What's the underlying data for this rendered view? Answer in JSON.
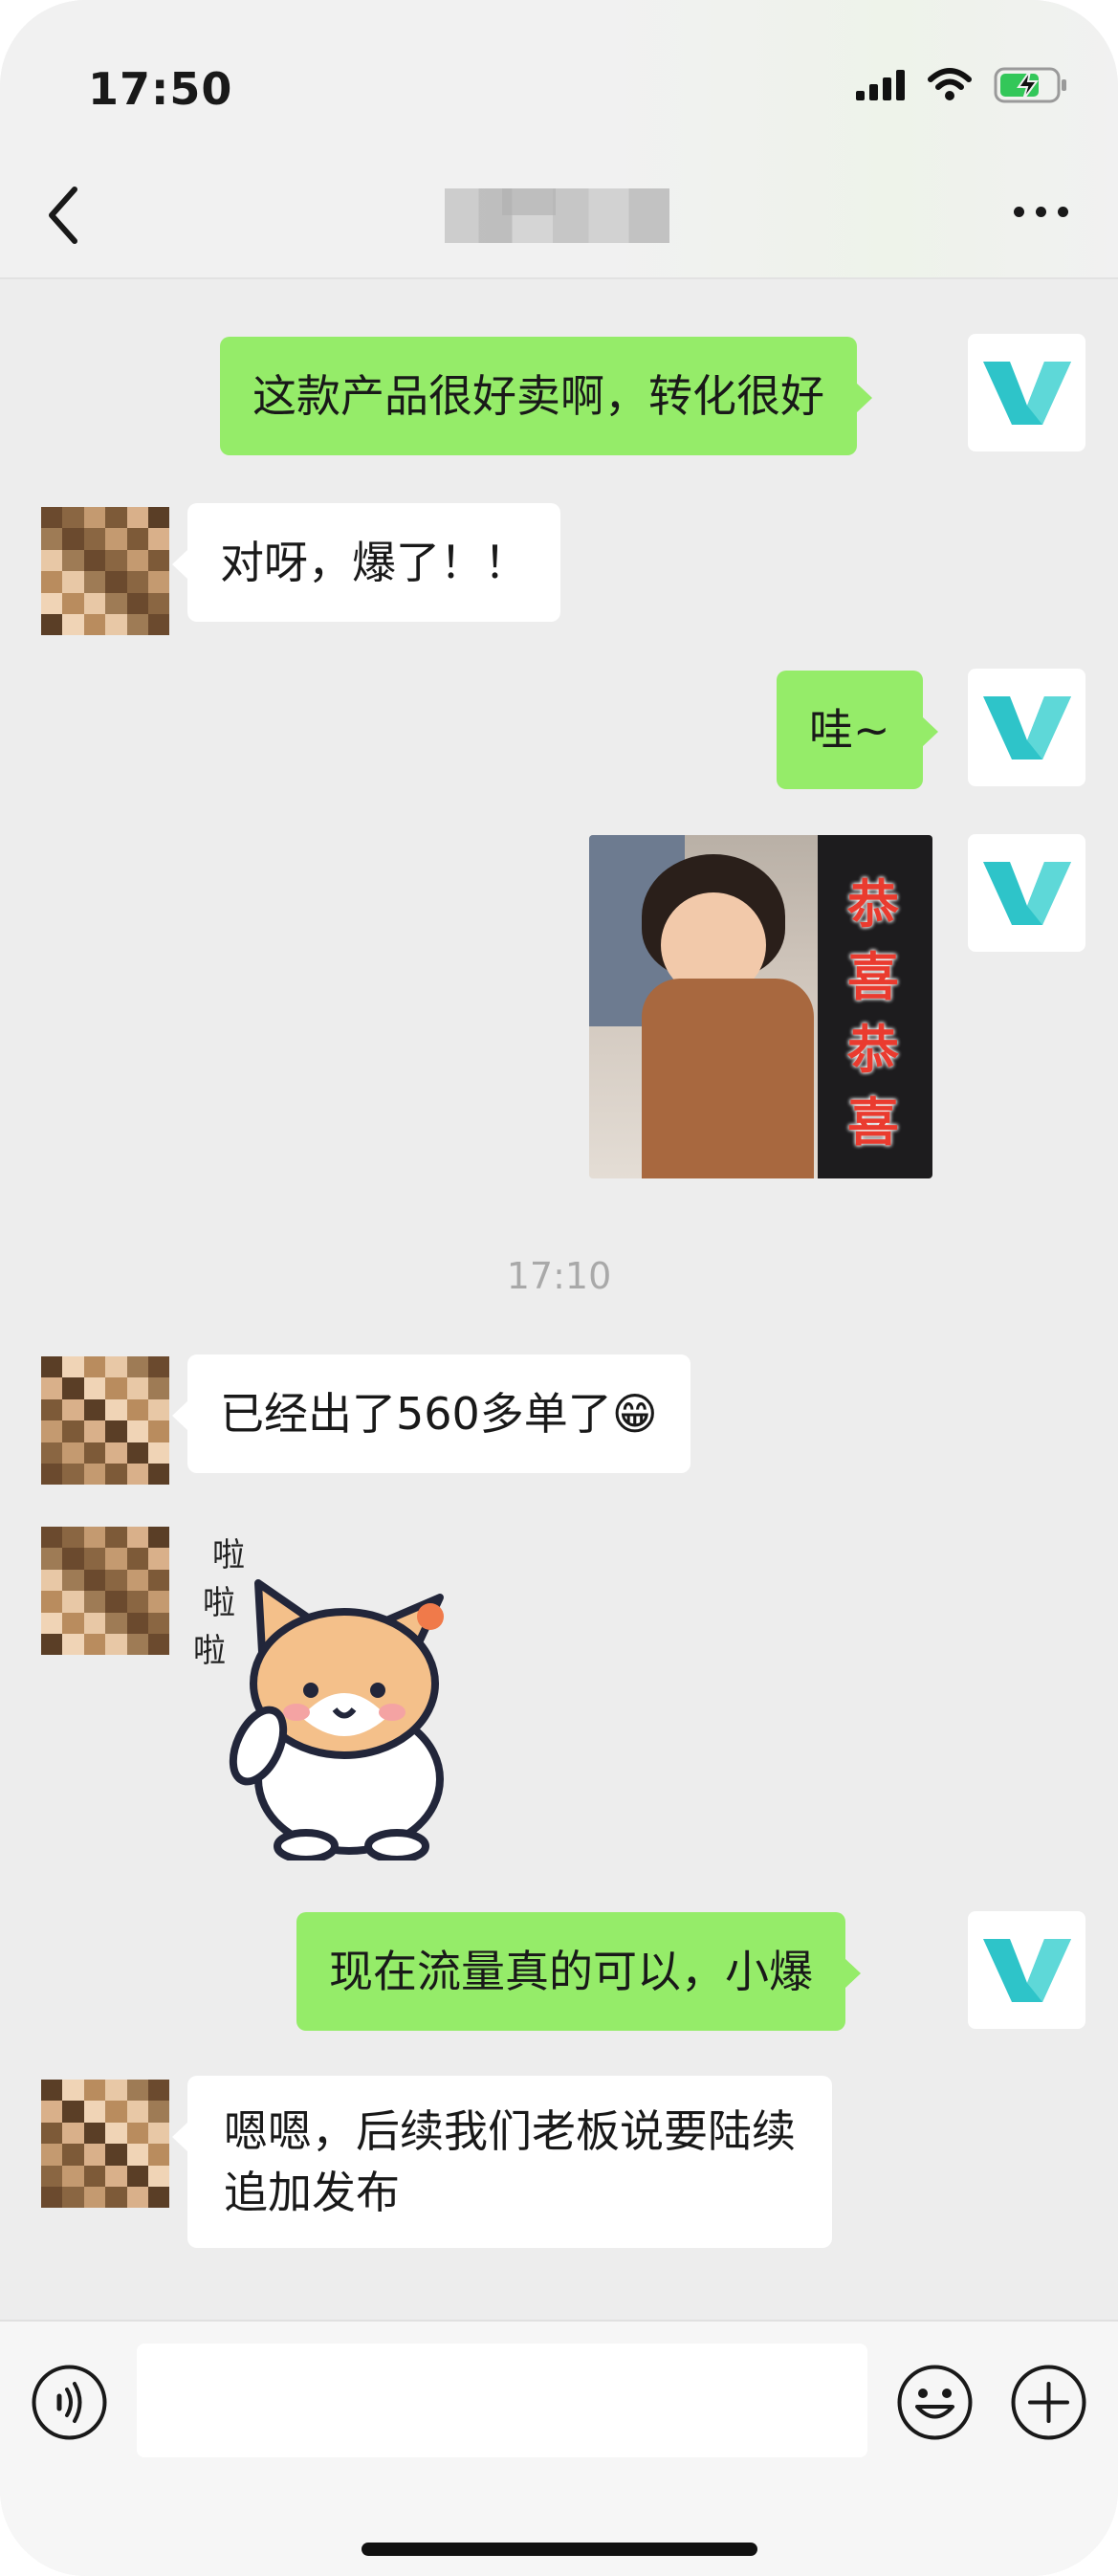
{
  "status_bar": {
    "time": "17:50"
  },
  "nav": {
    "title": ""
  },
  "messages": [
    {
      "from": "me",
      "text": "这款产品很好卖啊，转化很好"
    },
    {
      "from": "other",
      "text": "对呀，爆了！！"
    },
    {
      "from": "me",
      "text": "哇~"
    },
    {
      "from": "me",
      "type": "image",
      "caption": "恭喜恭喜"
    },
    {
      "type": "timestamp",
      "text": "17:10"
    },
    {
      "from": "other",
      "text": "已经出了560多单了😁"
    },
    {
      "from": "other",
      "type": "sticker",
      "caption": "啦啦啦"
    },
    {
      "from": "me",
      "text": "现在流量真的可以，小爆"
    },
    {
      "from": "other",
      "text": "嗯嗯，后续我们老板说要陆续",
      "text2": "追加发布"
    }
  ],
  "photo": {
    "line1": "恭",
    "line2": "喜",
    "line3": "恭",
    "line4": "喜"
  },
  "sticker": {
    "line1": "啦",
    "line2": "啦",
    "line3": "啦"
  },
  "input": {
    "placeholder": ""
  },
  "colors": {
    "bubble_me": "#95ec69",
    "bubble_other": "#ffffff",
    "background": "#ededed",
    "brand_v": "#2ec4c9"
  }
}
